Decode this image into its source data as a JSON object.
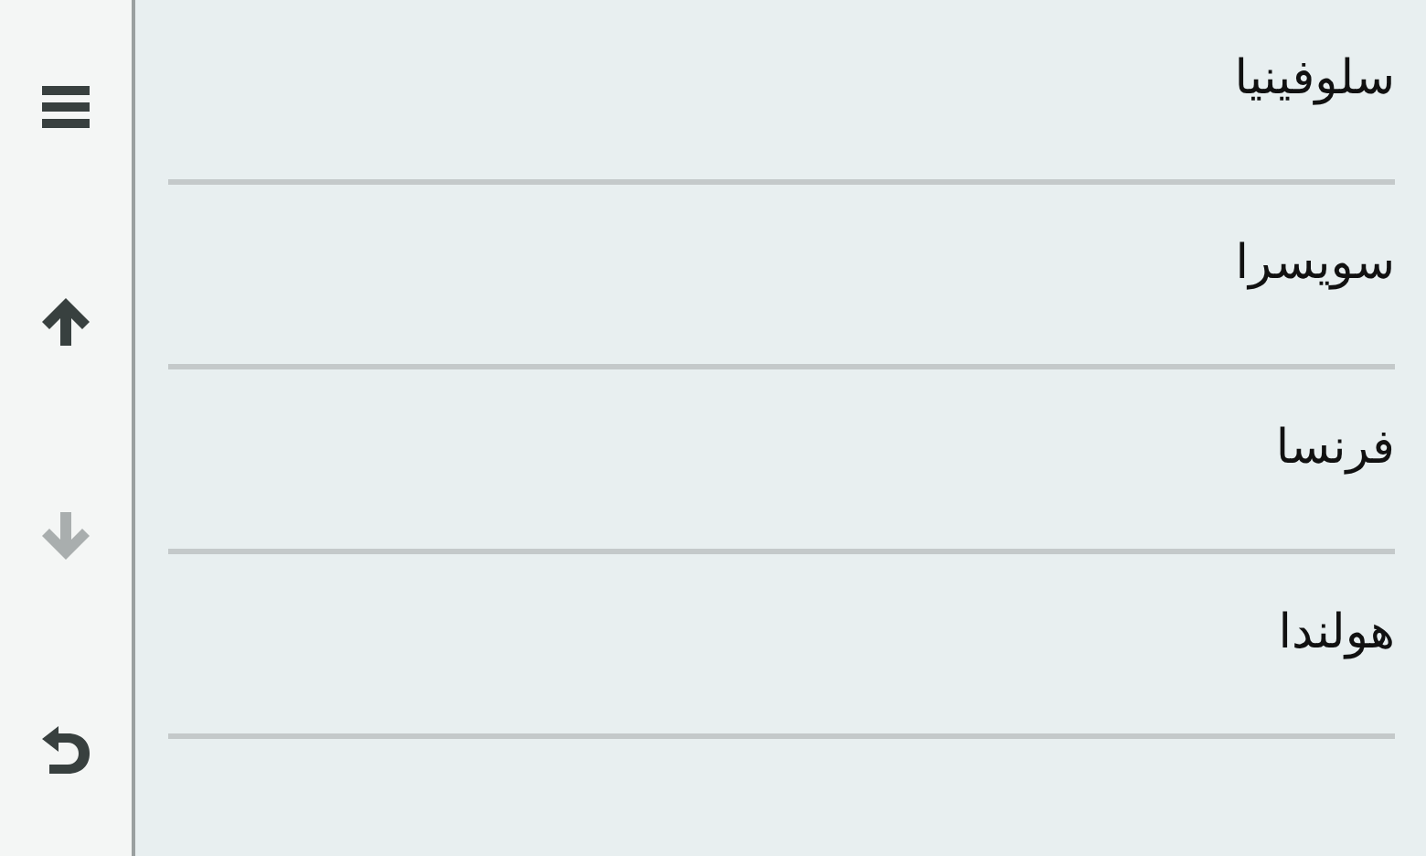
{
  "sidebar": {
    "buttons": [
      {
        "kind": "menu",
        "disabled": false
      },
      {
        "kind": "up",
        "disabled": false
      },
      {
        "kind": "down",
        "disabled": true
      },
      {
        "kind": "back",
        "disabled": false
      }
    ]
  },
  "list": {
    "items": [
      {
        "label": "سلوفينيا"
      },
      {
        "label": "سويسرا"
      },
      {
        "label": "فرنسا"
      },
      {
        "label": "هولندا"
      }
    ]
  }
}
